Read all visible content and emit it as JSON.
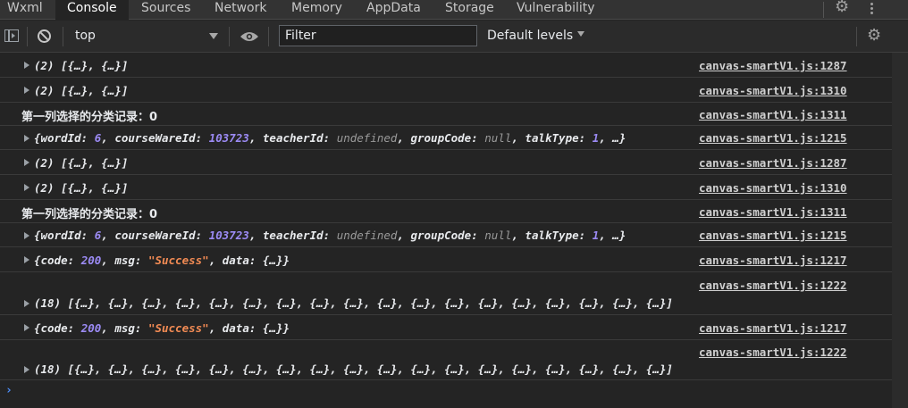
{
  "tabs": [
    "Wxml",
    "Console",
    "Sources",
    "Network",
    "Memory",
    "AppData",
    "Storage",
    "Vulnerability"
  ],
  "active_tab": "Console",
  "toolbar": {
    "context": "top",
    "filter_placeholder": "Filter",
    "levels": "Default levels"
  },
  "logs": [
    {
      "text": "(2) [{…}, {…}]",
      "source": "canvas-smartV1.js:1287",
      "expandable": true,
      "kind": "array"
    },
    {
      "text": "(2) [{…}, {…}]",
      "source": "canvas-smartV1.js:1310",
      "expandable": true,
      "kind": "array"
    },
    {
      "text": "第一列选择的分类记录：0",
      "source": "canvas-smartV1.js:1311",
      "expandable": false,
      "kind": "plain"
    },
    {
      "text": "{wordId: 6, courseWareId: 103723, teacherId: undefined, groupCode: null, talkType: 1, …}",
      "source": "canvas-smartV1.js:1215",
      "expandable": true,
      "kind": "object1"
    },
    {
      "text": "(2) [{…}, {…}]",
      "source": "canvas-smartV1.js:1287",
      "expandable": true,
      "kind": "array"
    },
    {
      "text": "(2) [{…}, {…}]",
      "source": "canvas-smartV1.js:1310",
      "expandable": true,
      "kind": "array"
    },
    {
      "text": "第一列选择的分类记录：0",
      "source": "canvas-smartV1.js:1311",
      "expandable": false,
      "kind": "plain"
    },
    {
      "text": "{wordId: 6, courseWareId: 103723, teacherId: undefined, groupCode: null, talkType: 1, …}",
      "source": "canvas-smartV1.js:1215",
      "expandable": true,
      "kind": "object1"
    },
    {
      "text": "{code: 200, msg: \"Success\", data: {…}}",
      "source": "canvas-smartV1.js:1217",
      "expandable": true,
      "kind": "object2"
    },
    {
      "text": "(18) [{…}, {…}, {…}, {…}, {…}, {…}, {…}, {…}, {…}, {…}, {…}, {…}, {…}, {…}, {…}, {…}, {…}, {…}]",
      "source": "canvas-smartV1.js:1222",
      "expandable": true,
      "kind": "array18"
    },
    {
      "text": "{code: 200, msg: \"Success\", data: {…}}",
      "source": "canvas-smartV1.js:1217",
      "expandable": true,
      "kind": "object2"
    },
    {
      "text": "(18) [{…}, {…}, {…}, {…}, {…}, {…}, {…}, {…}, {…}, {…}, {…}, {…}, {…}, {…}, {…}, {…}, {…}, {…}]",
      "source": "canvas-smartV1.js:1222",
      "expandable": true,
      "kind": "array18"
    }
  ],
  "prompt": "›",
  "icons": [
    "gear-icon",
    "kebab-menu-icon",
    "sidebar-toggle-icon",
    "clear-console-icon",
    "eye-icon",
    "dropdown-arrow-icon",
    "expand-triangle-icon"
  ],
  "colors": {
    "background": "#242424",
    "number": "#9c8bf5",
    "string": "#f28b54",
    "prompt": "#4d90fe"
  }
}
